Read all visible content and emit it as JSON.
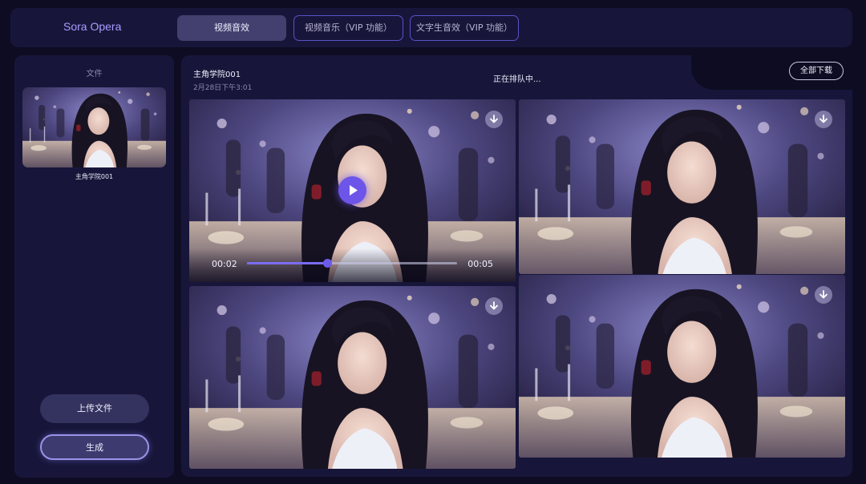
{
  "brand": "Sora Opera",
  "tabs": [
    {
      "label": "视频音效",
      "active": true
    },
    {
      "label": "视频音乐（VIP 功能）",
      "active": false
    },
    {
      "label": "文字生音效（VIP 功能）",
      "active": false
    }
  ],
  "sidebar": {
    "title": "文件",
    "file_name": "主角学院001",
    "upload_label": "上传文件",
    "generate_label": "生成"
  },
  "project": {
    "title": "主角学院001",
    "date": "2月28日下午3:01",
    "status": "正在排队中...",
    "download_all_label": "全部下载"
  },
  "player": {
    "current_time": "00:02",
    "duration": "00:05",
    "progress": 0.38
  },
  "colors": {
    "accent": "#6c55e8",
    "brand": "#a89cff",
    "panel": "#17163a",
    "background": "#0d0c22"
  }
}
